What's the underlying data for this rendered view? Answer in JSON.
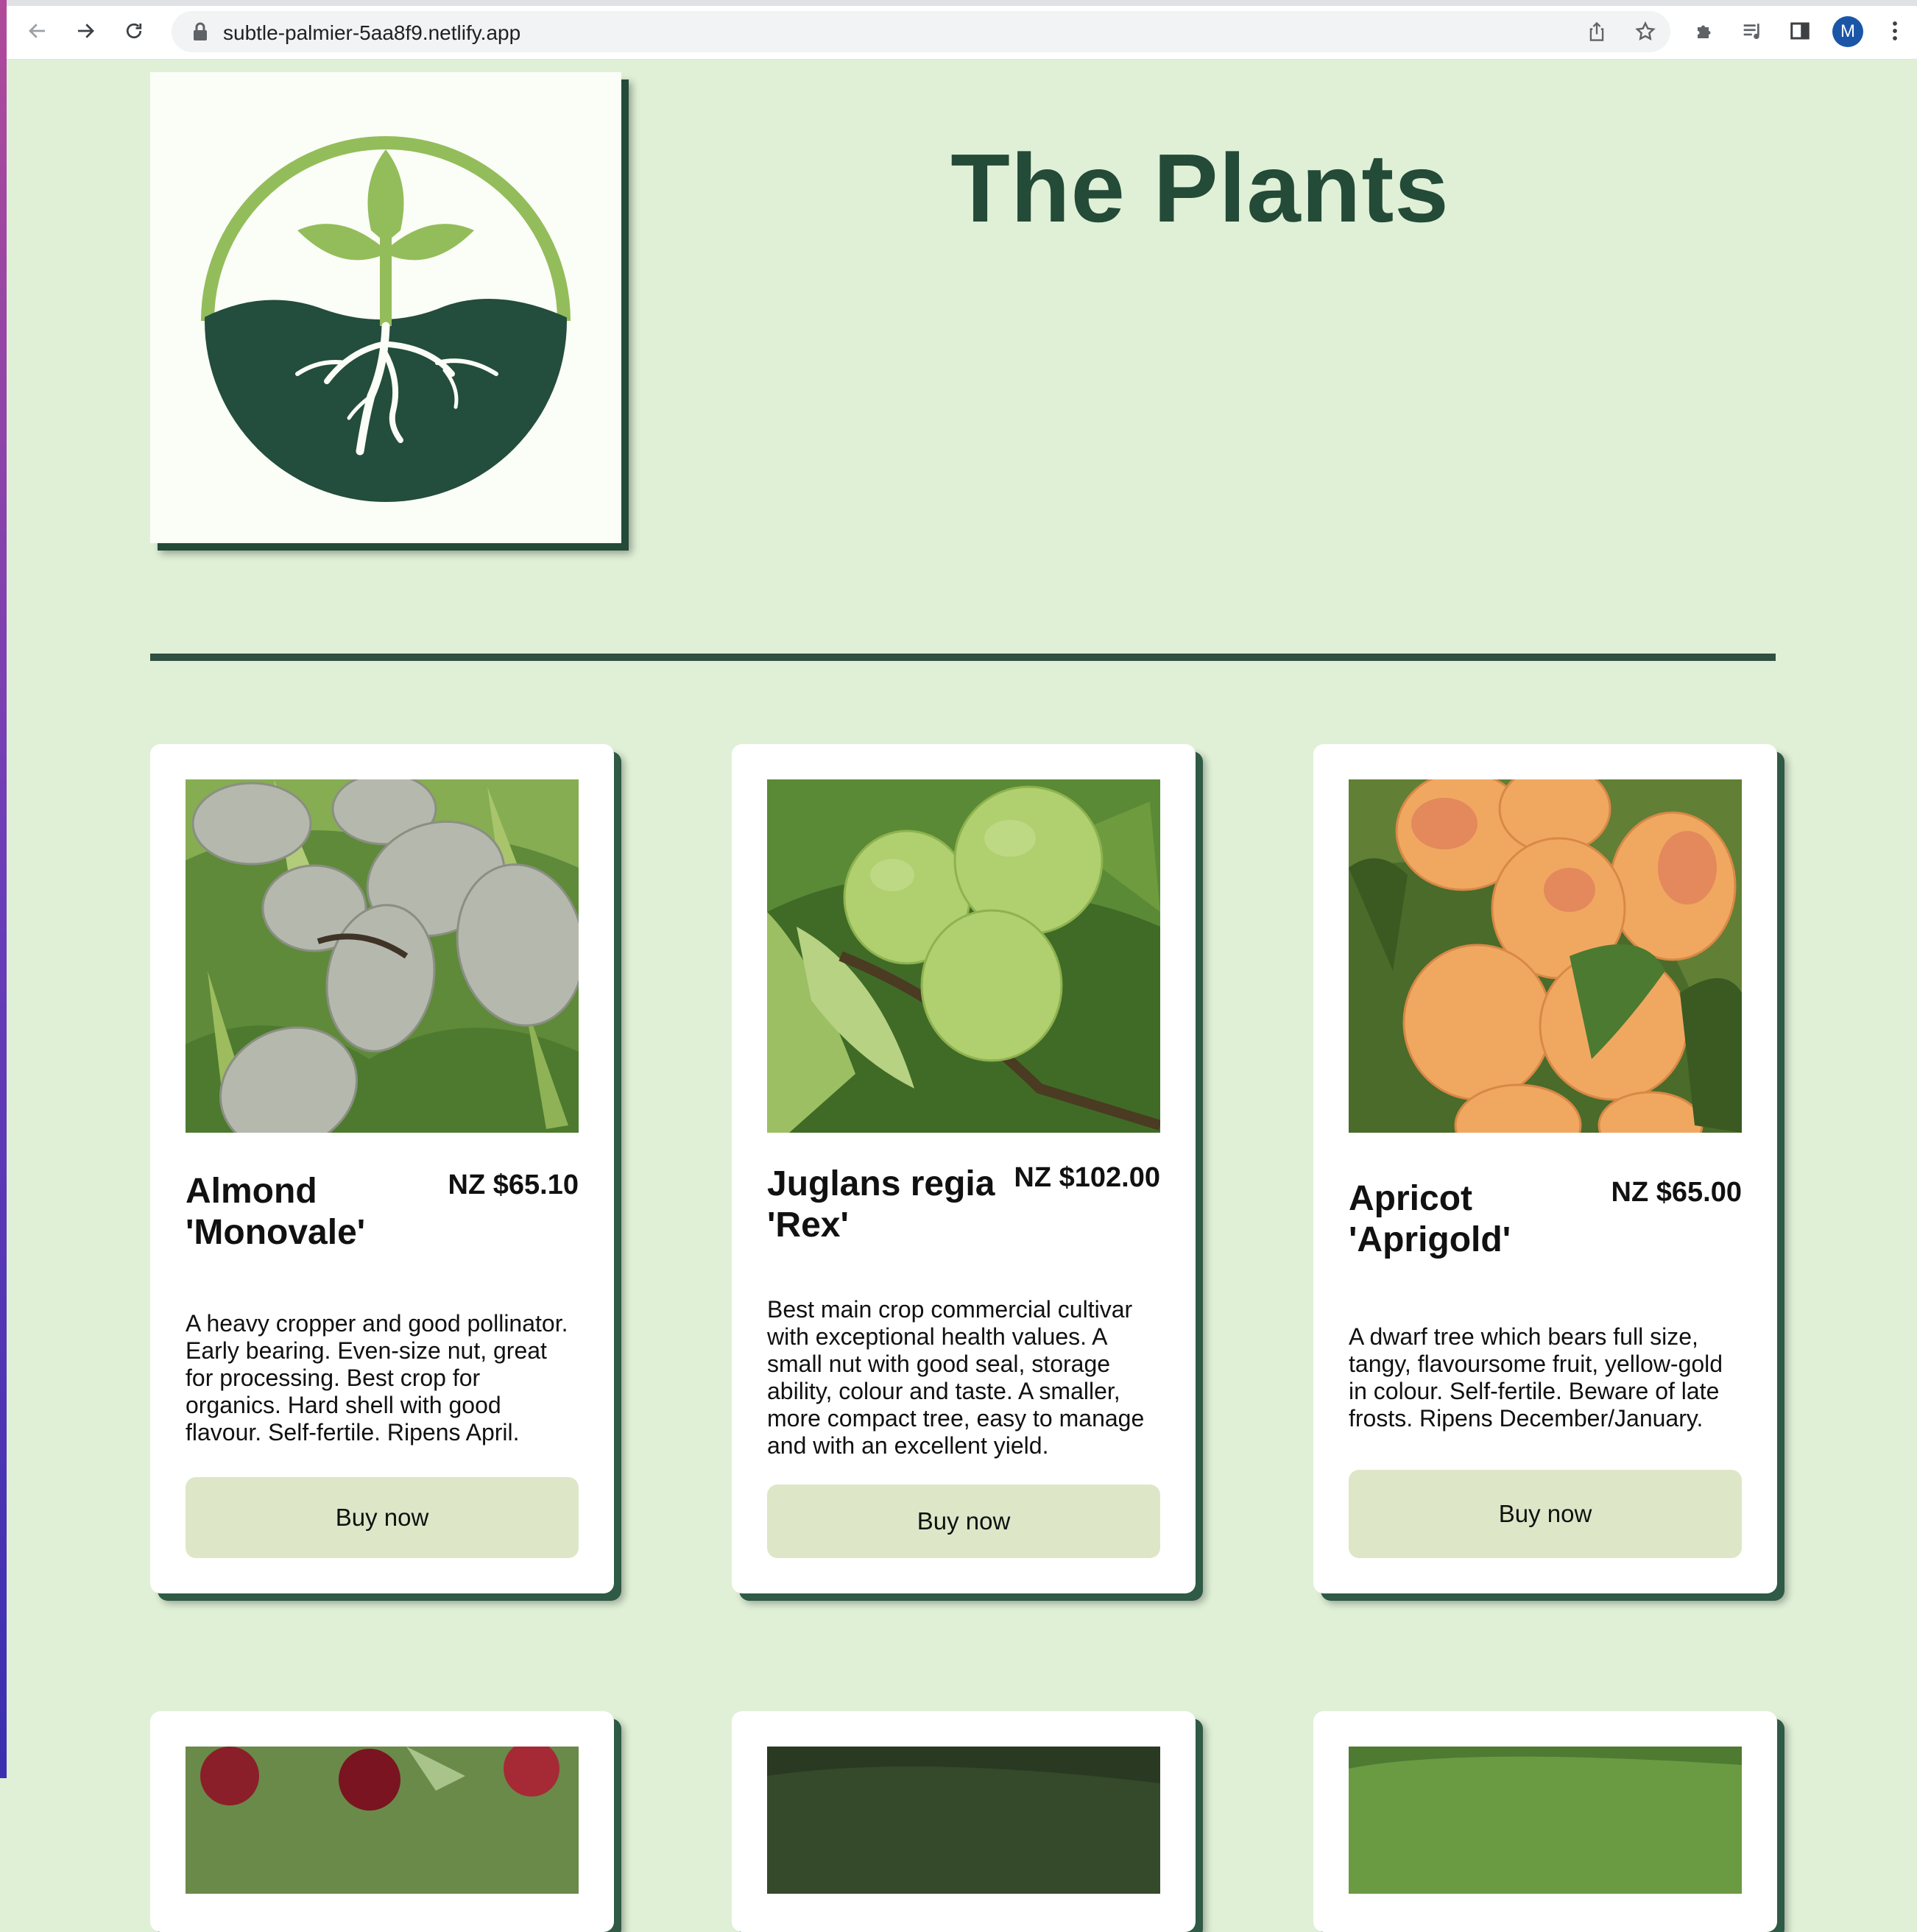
{
  "browser": {
    "url": "subtle-palmier-5aa8f9.netlify.app",
    "profile_initial": "M"
  },
  "page": {
    "title": "The Plants"
  },
  "colors": {
    "background": "#dff0d6",
    "accent_dark": "#244a38",
    "button": "#dde7c8"
  },
  "products": [
    {
      "name": "Almond 'Monovale'",
      "price": "NZ $65.10",
      "description": "A heavy cropper and good pollinator. Early bearing. Even-size nut, great for processing. Best crop for organics. Hard shell with good flavour. Self-fertile. Ripens April.",
      "button": "Buy now"
    },
    {
      "name": "Juglans regia 'Rex'",
      "price": "NZ $102.00",
      "description": "Best main crop commercial cultivar with exceptional health values. A small nut with good seal, storage ability, colour and taste. A smaller, more compact tree, easy to manage and with an excellent yield.",
      "button": "Buy now"
    },
    {
      "name": "Apricot 'Aprigold'",
      "price": "NZ $65.00",
      "description": "A dwarf tree which bears full size, tangy, flavoursome fruit, yellow-gold in colour. Self-fertile. Beware of late frosts. Ripens December/January.",
      "button": "Buy now"
    }
  ]
}
